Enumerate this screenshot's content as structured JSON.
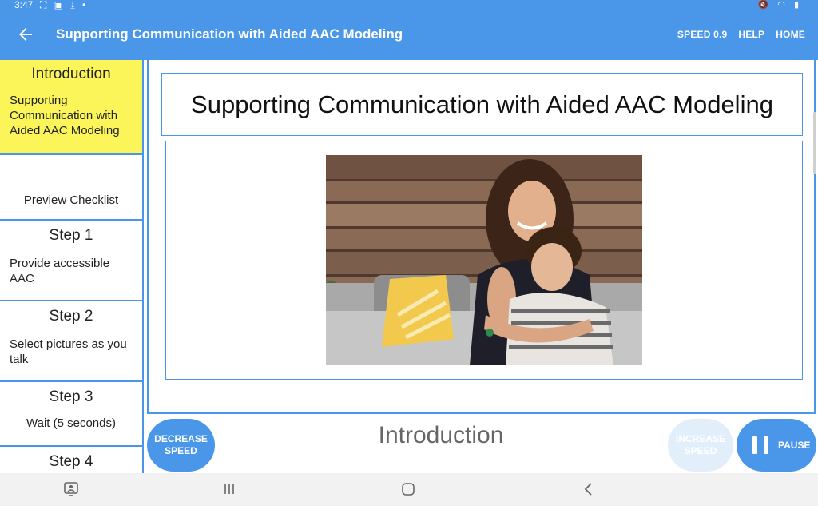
{
  "status_bar": {
    "time": "3:47",
    "notification_icons": [
      "screenshot-icon",
      "image-icon",
      "download-icon",
      "dot-icon"
    ],
    "system_icons": [
      "mute-icon",
      "wifi-icon",
      "battery-icon"
    ]
  },
  "app_bar": {
    "title": "Supporting Communication with Aided AAC Modeling",
    "speed_label": "SPEED 0.9",
    "help_label": "HELP",
    "home_label": "HOME"
  },
  "sidebar": {
    "intro": {
      "title": "Introduction",
      "description": "Supporting Communication with Aided AAC Modeling"
    },
    "preview": "Preview Checklist",
    "steps": [
      {
        "title": "Step 1",
        "description": "Provide accessible AAC"
      },
      {
        "title": "Step 2",
        "description": "Select pictures as you talk"
      },
      {
        "title": "Step 3",
        "description": "Wait (5 seconds)"
      },
      {
        "title": "Step 4",
        "description": ""
      }
    ]
  },
  "main": {
    "heading": "Supporting Communication with Aided AAC Modeling",
    "section_label": "Introduction"
  },
  "controls": {
    "decrease_line1": "DECREASE",
    "decrease_line2": "SPEED",
    "increase_line1": "INCREASE",
    "increase_line2": "SPEED",
    "pause_label": "PAUSE"
  },
  "colors": {
    "accent": "#4a97ea",
    "highlight": "#fbf55a",
    "disabled_button": "#e3eefb"
  }
}
